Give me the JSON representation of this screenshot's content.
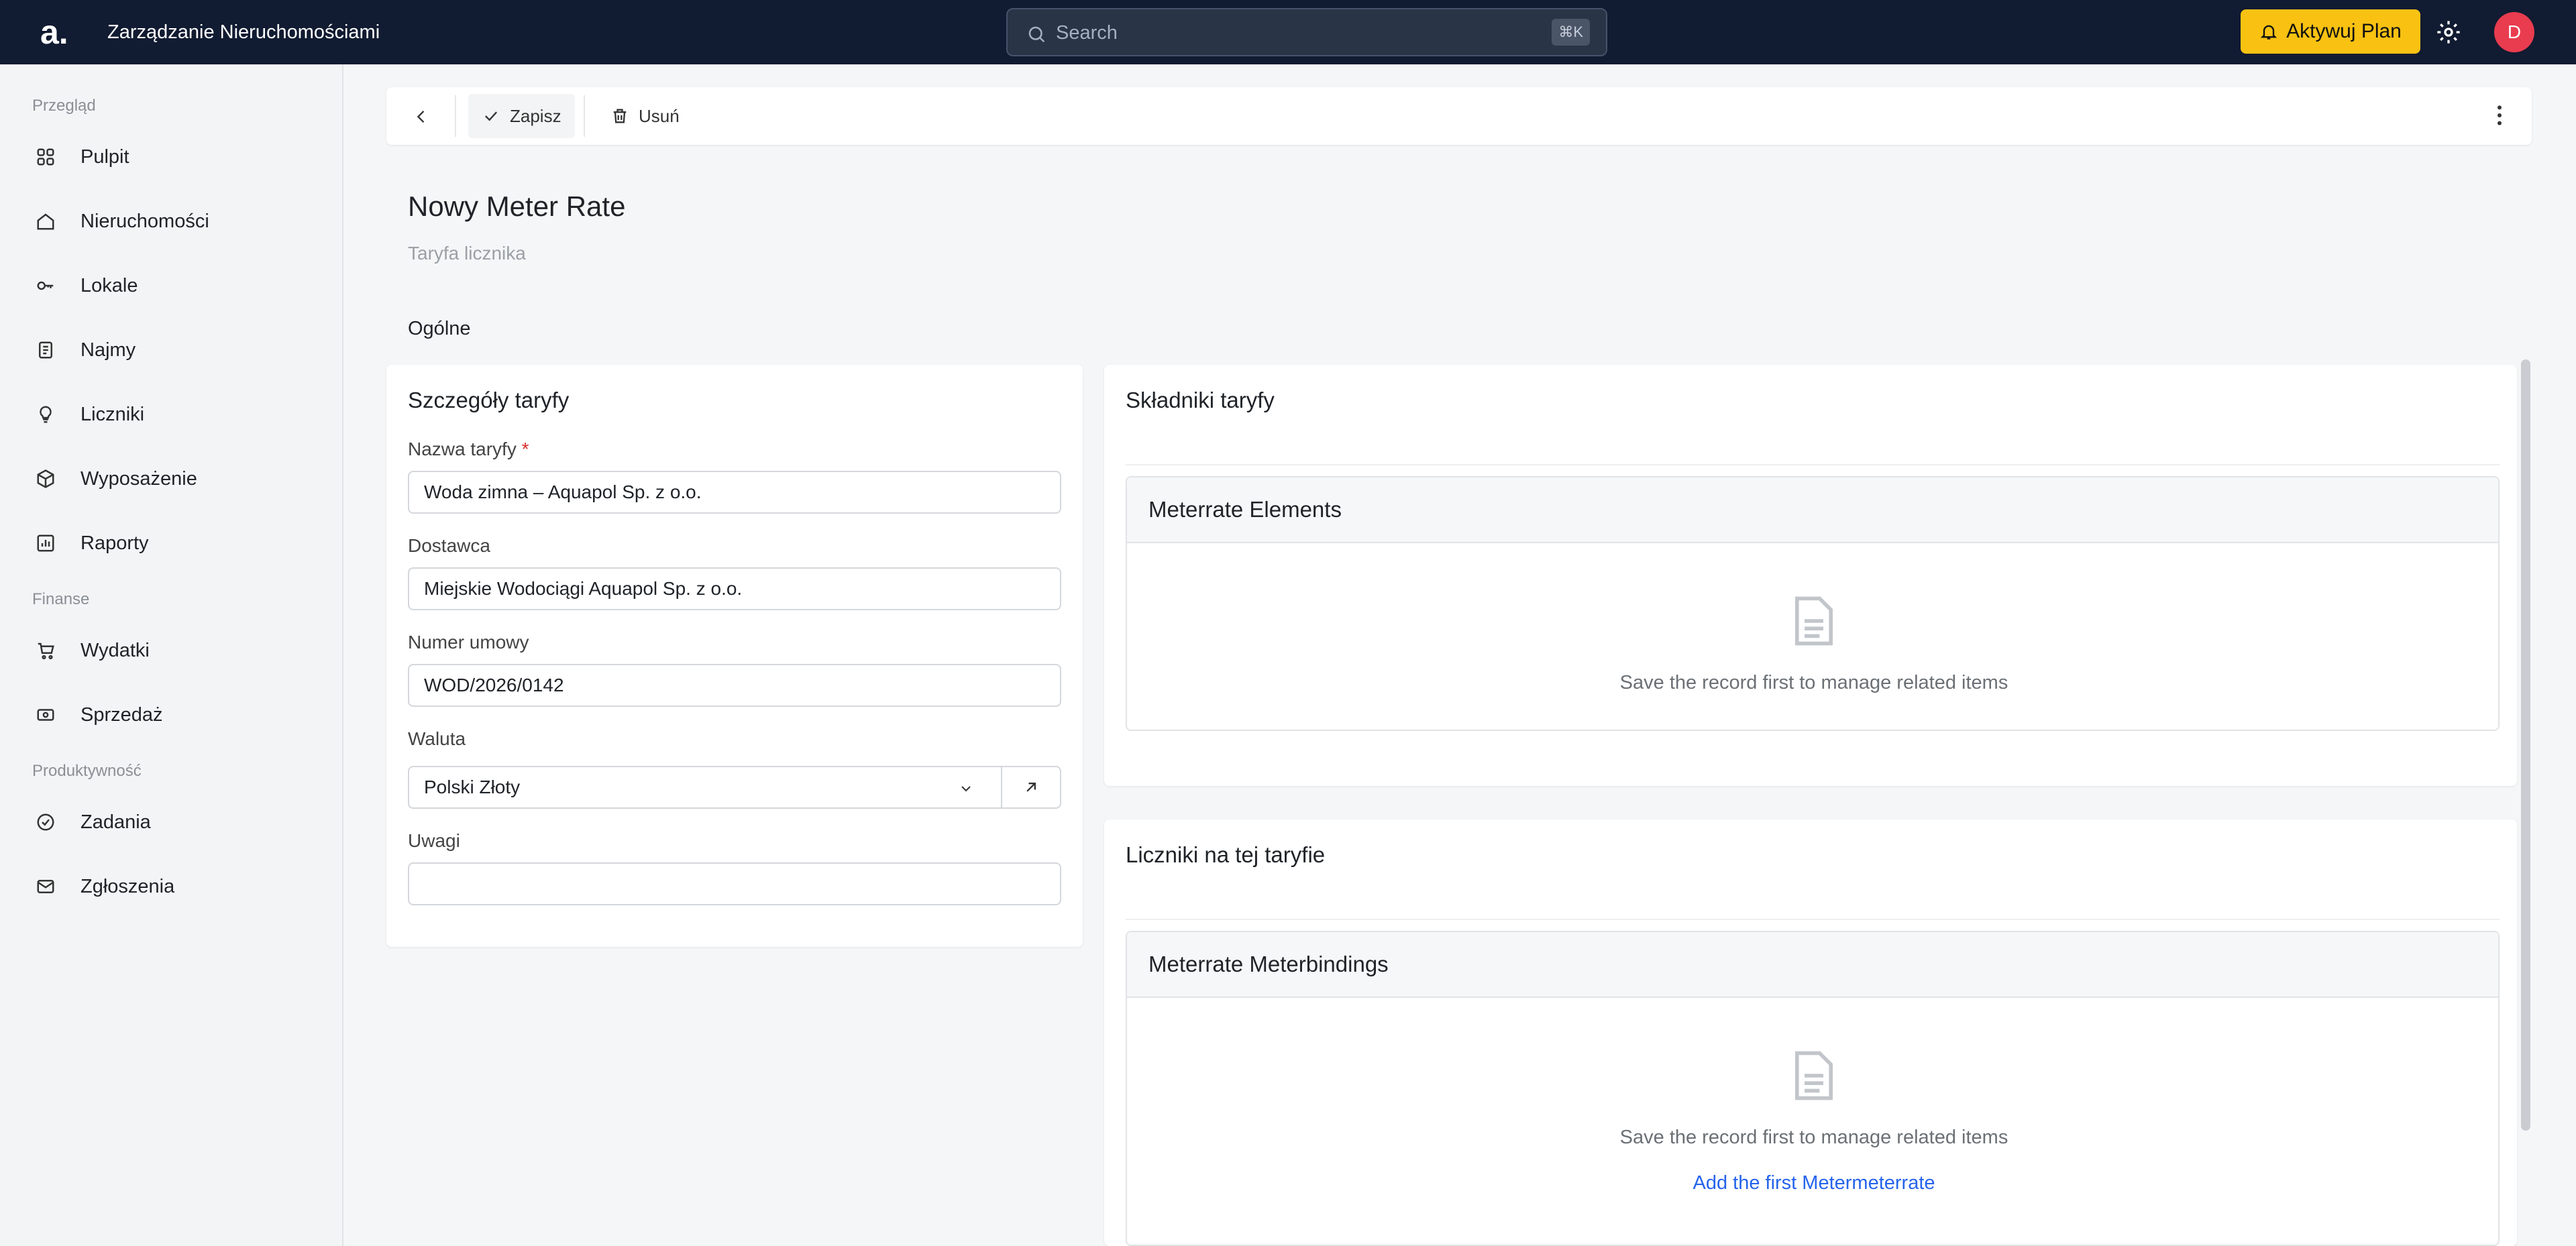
{
  "app": {
    "logo": "a.",
    "title": "Zarządzanie Nieruchomościami"
  },
  "search": {
    "placeholder": "Search",
    "shortcut": "⌘K"
  },
  "plan_button": "Aktywuj Plan",
  "avatar_initial": "D",
  "sidebar": {
    "sections": [
      {
        "label": "Przegląd",
        "items": [
          {
            "label": "Pulpit",
            "icon": "grid-icon"
          },
          {
            "label": "Nieruchomości",
            "icon": "building-icon"
          },
          {
            "label": "Lokale",
            "icon": "key-icon"
          },
          {
            "label": "Najmy",
            "icon": "document-icon"
          },
          {
            "label": "Liczniki",
            "icon": "bulb-icon"
          },
          {
            "label": "Wyposażenie",
            "icon": "box-icon"
          },
          {
            "label": "Raporty",
            "icon": "chart-icon"
          }
        ]
      },
      {
        "label": "Finanse",
        "items": [
          {
            "label": "Wydatki",
            "icon": "cart-icon"
          },
          {
            "label": "Sprzedaż",
            "icon": "money-icon"
          }
        ]
      },
      {
        "label": "Produktywność",
        "items": [
          {
            "label": "Zadania",
            "icon": "check-circle-icon"
          },
          {
            "label": "Zgłoszenia",
            "icon": "mail-icon"
          }
        ]
      }
    ]
  },
  "toolbar": {
    "save_label": "Zapisz",
    "delete_label": "Usuń"
  },
  "page": {
    "title": "Nowy Meter Rate",
    "subtitle": "Taryfa licznika",
    "tab": "Ogólne"
  },
  "details_card": {
    "title": "Szczegóły taryfy",
    "fields": {
      "name": {
        "label": "Nazwa taryfy",
        "value": "Woda zimna – Aquapol Sp. z o.o.",
        "required_mark": "*"
      },
      "supplier": {
        "label": "Dostawca",
        "value": "Miejskie Wodociągi Aquapol Sp. z o.o."
      },
      "contract": {
        "label": "Numer umowy",
        "value": "WOD/2026/0142"
      },
      "currency": {
        "label": "Waluta",
        "value": "Polski Złoty"
      },
      "notes": {
        "label": "Uwagi",
        "value": ""
      }
    }
  },
  "components_card": {
    "title": "Składniki taryfy",
    "panel_title": "Meterrate Elements",
    "empty_text": "Save the record first to manage related items"
  },
  "meters_card": {
    "title": "Liczniki na tej taryfie",
    "panel_title": "Meterrate Meterbindings",
    "empty_text": "Save the record first to manage related items",
    "add_link": "Add the first Metermeterrate"
  },
  "colors": {
    "topbar": "#111b31",
    "accent": "#f9c212",
    "avatar": "#e93c4f",
    "link": "#2563eb"
  }
}
